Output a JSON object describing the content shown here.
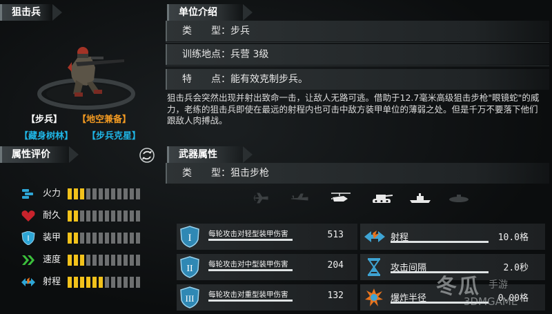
{
  "unit": {
    "name": "狙击兵",
    "tags": [
      {
        "text": "【步兵】",
        "color": "#ffffff"
      },
      {
        "text": "【地空兼备】",
        "color": "#f29a22"
      },
      {
        "text": "【藏身树林】",
        "color": "#1fb6e6"
      },
      {
        "text": "【步兵克星】",
        "color": "#1fb6e6"
      }
    ]
  },
  "intro": {
    "title": "单位介绍",
    "type_key": "类　　型：",
    "type_val": "步兵",
    "train_key": "训练地点：",
    "train_val": "兵营 3级",
    "feature_key": "特　　点：",
    "feature_val": "能有效克制步兵。",
    "description": "狙击兵会突然出现并射出致命一击，让敌人无路可逃。借助于12.7毫米高级狙击步枪\"眼镜蛇\"的威力，老练的狙击兵即使在最远的射程内也可击中敌方装甲单位的薄弱之处。但是千万不要落下他们跟敌人肉搏战。"
  },
  "attributes": {
    "title": "属性评价",
    "stats": [
      {
        "label": "火力",
        "value": 3,
        "icon": "bullets-icon",
        "color": "#2ea6d6"
      },
      {
        "label": "耐久",
        "value": 2,
        "icon": "heart-icon",
        "color": "#c8232c"
      },
      {
        "label": "装甲",
        "value": 2,
        "icon": "shield-icon",
        "color": "#2ea6d6"
      },
      {
        "label": "速度",
        "value": 3,
        "icon": "chevrons-icon",
        "color": "#3bbf3b"
      },
      {
        "label": "射程",
        "value": 6,
        "icon": "range-arrows-icon",
        "color": "#2ea6d6"
      }
    ],
    "max": 12
  },
  "weapon": {
    "title": "武器属性",
    "type_key": "类　　型：",
    "type_val": "狙击步枪",
    "targets": [
      {
        "icon": "fighter-jet-icon",
        "active": false
      },
      {
        "icon": "bomber-jet-icon",
        "active": false
      },
      {
        "icon": "helicopter-icon",
        "active": true
      },
      {
        "icon": "tank-icon",
        "active": true
      },
      {
        "icon": "ship-icon",
        "active": true
      },
      {
        "icon": "submarine-icon",
        "active": false
      }
    ],
    "damage": [
      {
        "label": "每轮攻击对轻型装甲伤害",
        "value": "513",
        "roman": "I"
      },
      {
        "label": "每轮攻击对中型装甲伤害",
        "value": "204",
        "roman": "II"
      },
      {
        "label": "每轮攻击对重型装甲伤害",
        "value": "132",
        "roman": "III"
      }
    ],
    "props": [
      {
        "label": "射程",
        "value": "10.0格",
        "icon": "range-icon"
      },
      {
        "label": "攻击间隔",
        "value": "2.0秒",
        "icon": "hourglass-icon"
      },
      {
        "label": "爆炸半径",
        "value": "0.00格",
        "icon": "explosion-icon"
      }
    ]
  },
  "watermark": {
    "line1": "冬瓜",
    "line2": "手游",
    "line3": "3DMGAME"
  }
}
